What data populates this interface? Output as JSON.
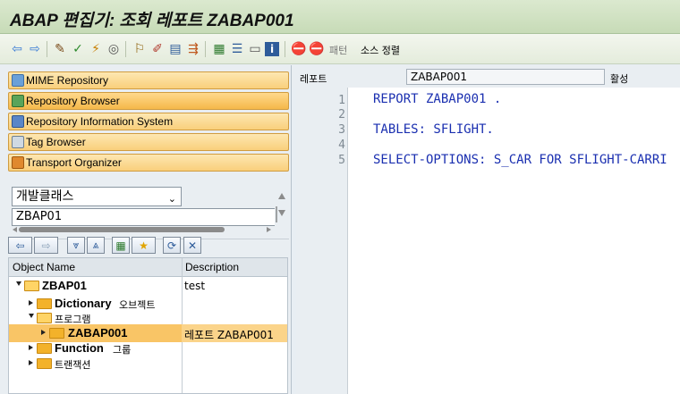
{
  "window": {
    "title": "ABAP 편집기: 조회 레포트 ZABAP001"
  },
  "toolbar": {
    "pattern_label": "패턴",
    "pretty_printer_label": "소스 정렬"
  },
  "nav": {
    "items": [
      {
        "label": "MIME Repository",
        "icon": "mime-icon"
      },
      {
        "label": "Repository Browser",
        "icon": "repository-browser-icon"
      },
      {
        "label": "Repository Information System",
        "icon": "info-system-icon"
      },
      {
        "label": "Tag Browser",
        "icon": "tag-icon"
      },
      {
        "label": "Transport Organizer",
        "icon": "truck-icon"
      }
    ]
  },
  "browser": {
    "object_type": "개발클래스",
    "object_name": "ZBAP01"
  },
  "tree": {
    "headers": {
      "name": "Object Name",
      "description": "Description"
    },
    "rows": [
      {
        "label": "ZBAP01",
        "desc": "test"
      },
      {
        "label": "Dictionary",
        "suffix": "오브젝트",
        "desc": ""
      },
      {
        "label": "프로그램",
        "desc": ""
      },
      {
        "label": "ZABAP001",
        "desc": "레포트 ZABAP001"
      },
      {
        "label": "Function",
        "suffix": "그룹",
        "desc": ""
      },
      {
        "label": "트랜잭션",
        "desc": ""
      }
    ]
  },
  "editor": {
    "report_label": "레포트",
    "report_name": "ZABAP001",
    "status": "활성",
    "line_numbers": [
      "1",
      "2",
      "3",
      "4",
      "5"
    ],
    "lines": [
      "REPORT ZABAP001 .",
      "",
      "TABLES: SFLIGHT.",
      "",
      "SELECT-OPTIONS: S_CAR FOR SFLIGHT-CARRI"
    ]
  }
}
